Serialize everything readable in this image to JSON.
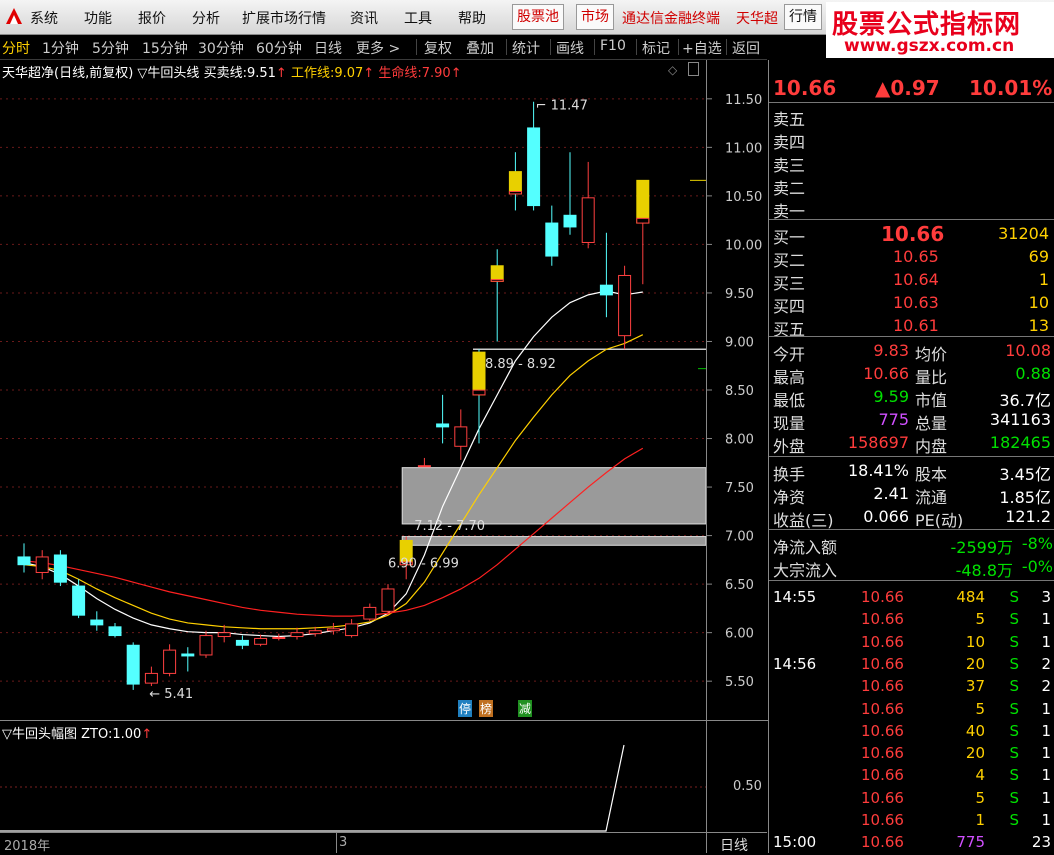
{
  "menubar": {
    "items": [
      "系统",
      "功能",
      "报价",
      "分析",
      "扩展市场行情",
      "资讯",
      "工具",
      "帮助"
    ],
    "gupiaochi": "股票池",
    "shichang": "市场",
    "tdx": "通达信金融终端",
    "tianhua": "天华超",
    "hangqing": "行情"
  },
  "watermark": {
    "line1": "股票公式指标网",
    "line2": "www.gszx.com.cn"
  },
  "periodbar": {
    "items": [
      "分时",
      "1分钟",
      "5分钟",
      "15分钟",
      "30分钟",
      "60分钟",
      "日线",
      "更多 >"
    ],
    "tools": [
      "复权",
      "叠加",
      "统计",
      "画线",
      "F10",
      "标记",
      "+自选",
      "返回"
    ]
  },
  "main_chart": {
    "name": "天华超净(日线,前复权)",
    "indicator": "▽牛回头线",
    "buy_label": "买卖线:",
    "buy_value": "9.51",
    "work_label": "工作线:",
    "work_value": "9.07",
    "life_label": "生命线:",
    "life_value": "7.90",
    "high_label": "11.47",
    "low_label": "5.41",
    "range1": "8.89 - 8.92",
    "range2": "7.12 - 7.70",
    "range3": "6.90 - 6.99",
    "badge1": "停",
    "badge2": "榜",
    "badge3": "减"
  },
  "indicator_panel": {
    "title": "▽牛回头幅图",
    "zto_label": "ZTO:",
    "zto_value": "1.00",
    "axis_label": "0.50"
  },
  "bottom_axis": {
    "year": "2018年",
    "month": "3",
    "period": "日线"
  },
  "chart_data": {
    "type": "candlestick",
    "y_ticks": [
      "11.50",
      "11.00",
      "10.50",
      "10.00",
      "9.50",
      "9.00",
      "8.50",
      "8.00",
      "7.50",
      "7.00",
      "6.50",
      "6.00",
      "5.50"
    ],
    "ylim": [
      5.1,
      11.9
    ],
    "candles": [
      {
        "o": 6.78,
        "c": 6.7,
        "h": 6.92,
        "l": 6.62
      },
      {
        "o": 6.62,
        "c": 6.78,
        "h": 6.85,
        "l": 6.55
      },
      {
        "o": 6.8,
        "c": 6.52,
        "h": 6.85,
        "l": 6.48
      },
      {
        "o": 6.48,
        "c": 6.18,
        "h": 6.55,
        "l": 6.15
      },
      {
        "o": 6.13,
        "c": 6.08,
        "h": 6.22,
        "l": 6.02
      },
      {
        "o": 6.06,
        "c": 5.97,
        "h": 6.1,
        "l": 5.95
      },
      {
        "o": 5.87,
        "c": 5.47,
        "h": 5.9,
        "l": 5.41
      },
      {
        "o": 5.48,
        "c": 5.58,
        "h": 5.65,
        "l": 5.45
      },
      {
        "o": 5.58,
        "c": 5.82,
        "h": 5.88,
        "l": 5.55
      },
      {
        "o": 5.78,
        "c": 5.76,
        "h": 5.85,
        "l": 5.6
      },
      {
        "o": 5.77,
        "c": 5.97,
        "h": 6.02,
        "l": 5.74
      },
      {
        "o": 5.96,
        "c": 6.0,
        "h": 6.08,
        "l": 5.9
      },
      {
        "o": 5.92,
        "c": 5.87,
        "h": 5.97,
        "l": 5.83
      },
      {
        "o": 5.88,
        "c": 5.94,
        "h": 5.98,
        "l": 5.86
      },
      {
        "o": 5.94,
        "c": 5.95,
        "h": 5.99,
        "l": 5.92
      },
      {
        "o": 5.96,
        "c": 6.0,
        "h": 6.05,
        "l": 5.93
      },
      {
        "o": 5.99,
        "c": 6.02,
        "h": 6.06,
        "l": 5.96
      },
      {
        "o": 6.02,
        "c": 6.04,
        "h": 6.1,
        "l": 5.98
      },
      {
        "o": 5.97,
        "c": 6.09,
        "h": 6.14,
        "l": 5.95
      },
      {
        "o": 6.14,
        "c": 6.26,
        "h": 6.3,
        "l": 6.12
      },
      {
        "o": 6.22,
        "c": 6.45,
        "h": 6.5,
        "l": 6.18
      },
      {
        "o": 6.7,
        "c": 6.95,
        "h": 6.99,
        "l": 6.55
      },
      {
        "o": 7.72,
        "c": 7.72,
        "h": 7.8,
        "l": 7.72
      },
      {
        "o": 8.15,
        "c": 8.12,
        "h": 8.45,
        "l": 7.95
      },
      {
        "o": 7.92,
        "c": 8.12,
        "h": 8.3,
        "l": 7.78
      },
      {
        "o": 8.89,
        "c": 8.45,
        "h": 8.92,
        "l": 7.95
      },
      {
        "o": 9.78,
        "c": 9.62,
        "h": 9.95,
        "l": 9.0
      },
      {
        "o": 10.75,
        "c": 10.52,
        "h": 10.95,
        "l": 10.35
      },
      {
        "o": 11.2,
        "c": 10.4,
        "h": 11.47,
        "l": 10.35
      },
      {
        "o": 10.22,
        "c": 9.88,
        "h": 10.4,
        "l": 9.78
      },
      {
        "o": 10.3,
        "c": 10.18,
        "h": 10.95,
        "l": 10.1
      },
      {
        "o": 10.02,
        "c": 10.48,
        "h": 10.85,
        "l": 9.96
      },
      {
        "o": 9.58,
        "c": 9.48,
        "h": 10.12,
        "l": 9.25
      },
      {
        "o": 9.06,
        "c": 9.68,
        "h": 9.78,
        "l": 8.92
      },
      {
        "o": 10.22,
        "c": 10.66,
        "h": 10.66,
        "l": 9.59
      }
    ],
    "gaps": [
      {
        "lo": 7.12,
        "hi": 7.7,
        "filled": true
      },
      {
        "lo": 6.9,
        "hi": 6.99,
        "filled": true
      },
      {
        "lo": 8.89,
        "hi": 8.92,
        "filled": false
      }
    ],
    "lines": [
      {
        "name": "买卖线",
        "color": "#ffffff",
        "values": [
          6.72,
          6.68,
          6.6,
          6.48,
          6.35,
          6.24,
          6.15,
          6.08,
          6.04,
          6.01,
          6.0,
          6.0,
          5.98,
          5.97,
          5.96,
          5.97,
          5.99,
          6.02,
          6.05,
          6.1,
          6.2,
          6.4,
          6.8,
          7.3,
          7.7,
          8.1,
          8.45,
          8.8,
          9.05,
          9.25,
          9.4,
          9.48,
          9.52,
          9.48,
          9.51
        ]
      },
      {
        "name": "工作线",
        "color": "#ffd000",
        "values": [
          6.7,
          6.68,
          6.64,
          6.55,
          6.45,
          6.36,
          6.28,
          6.2,
          6.14,
          6.1,
          6.08,
          6.06,
          6.05,
          6.04,
          6.04,
          6.04,
          6.05,
          6.06,
          6.08,
          6.11,
          6.18,
          6.3,
          6.52,
          6.82,
          7.12,
          7.42,
          7.7,
          7.98,
          8.22,
          8.45,
          8.65,
          8.8,
          8.92,
          8.98,
          9.07
        ]
      },
      {
        "name": "生命线",
        "color": "#ff2020",
        "values": [
          6.74,
          6.72,
          6.69,
          6.65,
          6.61,
          6.57,
          6.52,
          6.47,
          6.42,
          6.38,
          6.34,
          6.3,
          6.26,
          6.23,
          6.21,
          6.19,
          6.18,
          6.17,
          6.17,
          6.18,
          6.2,
          6.23,
          6.28,
          6.36,
          6.45,
          6.56,
          6.7,
          6.86,
          7.02,
          7.18,
          7.34,
          7.5,
          7.65,
          7.79,
          7.9
        ]
      }
    ]
  },
  "quote": {
    "price": "10.66",
    "change": "▲0.97",
    "pct": "10.01%",
    "sell_labels": [
      "卖五",
      "卖四",
      "卖三",
      "卖二",
      "卖一"
    ],
    "buy": [
      {
        "label": "买一",
        "price": "10.66",
        "vol": "31204"
      },
      {
        "label": "买二",
        "price": "10.65",
        "vol": "69"
      },
      {
        "label": "买三",
        "price": "10.64",
        "vol": "1"
      },
      {
        "label": "买四",
        "price": "10.63",
        "vol": "10"
      },
      {
        "label": "买五",
        "price": "10.61",
        "vol": "13"
      }
    ],
    "stats": [
      {
        "l1": "今开",
        "v1": "9.83",
        "c1": "red",
        "l2": "均价",
        "v2": "10.08",
        "c2": "red"
      },
      {
        "l1": "最高",
        "v1": "10.66",
        "c1": "red",
        "l2": "量比",
        "v2": "0.88",
        "c2": "green"
      },
      {
        "l1": "最低",
        "v1": "9.59",
        "c1": "green",
        "l2": "市值",
        "v2": "36.7亿",
        "c2": "white"
      },
      {
        "l1": "现量",
        "v1": "775",
        "c1": "purple",
        "l2": "总量",
        "v2": "341163",
        "c2": "white"
      },
      {
        "l1": "外盘",
        "v1": "158697",
        "c1": "red",
        "l2": "内盘",
        "v2": "182465",
        "c2": "green"
      }
    ],
    "stats2": [
      {
        "l1": "换手",
        "v1": "18.41%",
        "l2": "股本",
        "v2": "3.45亿"
      },
      {
        "l1": "净资",
        "v1": "2.41",
        "l2": "流通",
        "v2": "1.85亿"
      },
      {
        "l1": "收益(三)",
        "v1": "0.066",
        "l2": "PE(动)",
        "v2": "121.2"
      }
    ],
    "flow": [
      {
        "label": "净流入额",
        "v": "-2599万",
        "p": "-8%"
      },
      {
        "label": "大宗流入",
        "v": "-48.8万",
        "p": "-0%"
      }
    ],
    "ticks": [
      {
        "time": "14:55",
        "price": "10.66",
        "vol": "484",
        "bs": "S",
        "n": "3"
      },
      {
        "time": "",
        "price": "10.66",
        "vol": "5",
        "bs": "S",
        "n": "1"
      },
      {
        "time": "",
        "price": "10.66",
        "vol": "10",
        "bs": "S",
        "n": "1"
      },
      {
        "time": "14:56",
        "price": "10.66",
        "vol": "20",
        "bs": "S",
        "n": "2"
      },
      {
        "time": "",
        "price": "10.66",
        "vol": "37",
        "bs": "S",
        "n": "2"
      },
      {
        "time": "",
        "price": "10.66",
        "vol": "5",
        "bs": "S",
        "n": "1"
      },
      {
        "time": "",
        "price": "10.66",
        "vol": "40",
        "bs": "S",
        "n": "1"
      },
      {
        "time": "",
        "price": "10.66",
        "vol": "20",
        "bs": "S",
        "n": "1"
      },
      {
        "time": "",
        "price": "10.66",
        "vol": "4",
        "bs": "S",
        "n": "1"
      },
      {
        "time": "",
        "price": "10.66",
        "vol": "5",
        "bs": "S",
        "n": "1"
      },
      {
        "time": "",
        "price": "10.66",
        "vol": "1",
        "bs": "S",
        "n": "1"
      },
      {
        "time": "15:00",
        "price": "10.66",
        "vol": "775",
        "bs": "",
        "n": "23"
      }
    ]
  }
}
